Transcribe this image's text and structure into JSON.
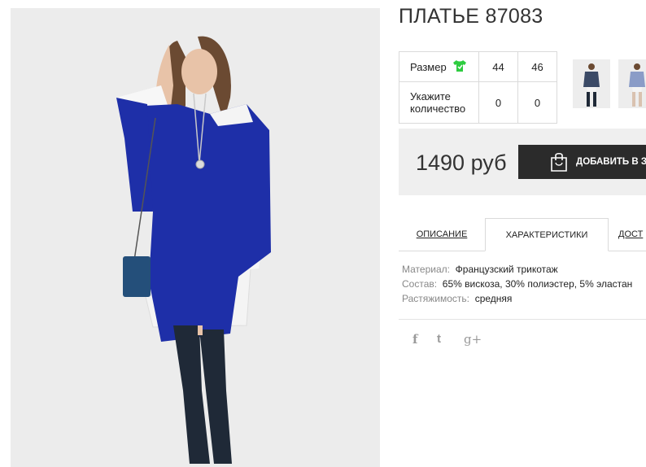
{
  "product": {
    "title": "ПЛАТЬЕ 87083",
    "image_alt": "model in blue tunic over white dress with knee-high boots"
  },
  "sizes": {
    "row_label": "Размер",
    "size_icon": "tshirt-icon",
    "values": [
      "44",
      "46"
    ],
    "qty_label": "Укажите количество",
    "quantities": [
      "0",
      "0"
    ]
  },
  "purchase": {
    "price": "1490 руб",
    "add_button": "ДОБАВИТЬ В ЗА",
    "button_icon": "shopping-bag-icon"
  },
  "tabs": [
    "ОПИСАНИЕ",
    "ХАРАКТЕРИСТИКИ",
    "ДОСТ"
  ],
  "characteristics": [
    {
      "key": "Материал:",
      "value": "Французский трикотаж"
    },
    {
      "key": "Состав:",
      "value": "65% вискоза, 30% полиэстер, 5% эластан"
    },
    {
      "key": "Растяжимость:",
      "value": "средняя"
    }
  ],
  "social": [
    "f",
    "t",
    "g+"
  ],
  "colors": {
    "accent_green": "#2ecc40",
    "blue_garment": "#1e2fa8",
    "button_dark": "#2b2b2b"
  }
}
